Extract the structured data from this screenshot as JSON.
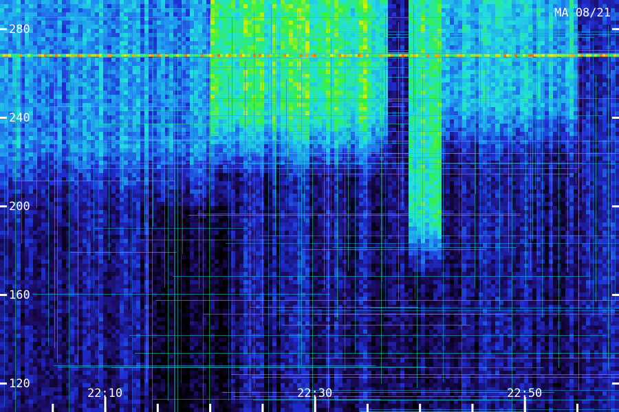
{
  "chart_data": {
    "type": "heatmap",
    "station_label": "MA 08/21",
    "y_ticks": [
      {
        "value": 120,
        "label": "120"
      },
      {
        "value": 160,
        "label": "160"
      },
      {
        "value": 200,
        "label": "200"
      },
      {
        "value": 240,
        "label": "240"
      },
      {
        "value": 280,
        "label": "280"
      }
    ],
    "ylim": [
      107,
      293
    ],
    "x_ticks": [
      {
        "value": "22:10",
        "label": "22:10"
      },
      {
        "value": "22:30",
        "label": "22:30"
      },
      {
        "value": "22:50",
        "label": "22:50"
      }
    ],
    "x_minor_ticks": [
      "22:05",
      "22:10",
      "22:15",
      "22:20",
      "22:25",
      "22:30",
      "22:35",
      "22:40",
      "22:45",
      "22:50",
      "22:55"
    ],
    "xlim": [
      "22:00",
      "22:59"
    ],
    "colormap": [
      "#000000",
      "#1a0a5a",
      "#1f2dd0",
      "#1f8ff0",
      "#22e0e0",
      "#33f04a",
      "#f0f000",
      "#ff2000"
    ],
    "intensity_regions": [
      {
        "x_start": "22:00",
        "x_end": "22:20",
        "y_start": 200,
        "y_end": 293,
        "level": 0.45
      },
      {
        "x_start": "22:20",
        "x_end": "22:37",
        "y_start": 215,
        "y_end": 293,
        "level": 0.75
      },
      {
        "x_start": "22:39",
        "x_end": "22:42",
        "y_start": 170,
        "y_end": 293,
        "level": 0.8
      },
      {
        "x_start": "22:42",
        "x_end": "22:55",
        "y_start": 220,
        "y_end": 293,
        "level": 0.55
      },
      {
        "x_start": "22:15",
        "x_end": "22:22",
        "y_start": 107,
        "y_end": 200,
        "level": 0.02
      }
    ],
    "hot_bands": [
      {
        "y": 268,
        "x_start": "22:00",
        "x_end": "22:59",
        "level": 0.95
      }
    ],
    "grid": false
  }
}
